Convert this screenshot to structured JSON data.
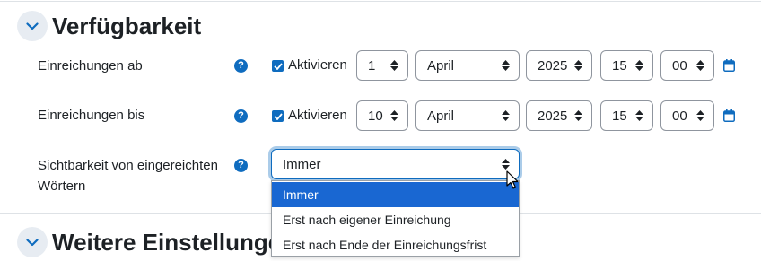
{
  "sections": {
    "availability_title": "Verfügbarkeit",
    "more_settings_title": "Weitere Einstellungen"
  },
  "rows": {
    "submissions_from": {
      "label": "Einreichungen ab",
      "enable_label": "Aktivieren",
      "enabled": true,
      "day": "1",
      "month": "April",
      "year": "2025",
      "hour": "15",
      "minute": "00"
    },
    "submissions_until": {
      "label": "Einreichungen bis",
      "enable_label": "Aktivieren",
      "enabled": true,
      "day": "10",
      "month": "April",
      "year": "2025",
      "hour": "15",
      "minute": "00"
    },
    "visibility": {
      "label": "Sichtbarkeit von eingereichten Wörtern",
      "selected": "Immer",
      "options": [
        "Immer",
        "Erst nach eigener Einreichung",
        "Erst nach Ende der Einreichungsfrist"
      ],
      "highlighted_index": 0
    }
  },
  "icons": {
    "help": "question-circle-icon",
    "calendar": "calendar-icon",
    "collapse": "chevron-down-icon",
    "cursor": "mouse-pointer-icon"
  },
  "colors": {
    "primary": "#0f6cbf",
    "dropdown_highlight": "#1967d2"
  }
}
